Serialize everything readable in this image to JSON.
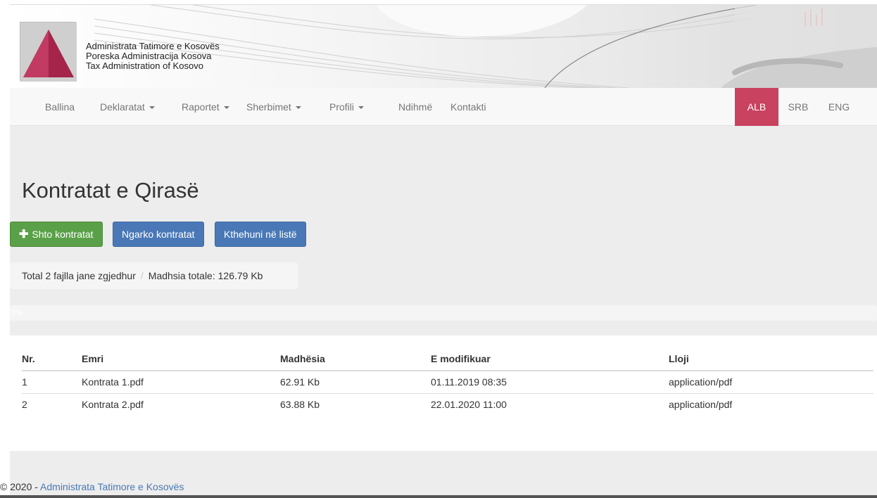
{
  "header": {
    "org_lines": [
      "Administrata Tatimore e Kosovës",
      "Poreska Administracija Kosova",
      "Tax Administration of Kosovo"
    ]
  },
  "nav": {
    "items": [
      {
        "label": "Ballina",
        "dropdown": false
      },
      {
        "label": "Deklaratat",
        "dropdown": true
      },
      {
        "label": "Raportet",
        "dropdown": true
      },
      {
        "label": "Sherbimet",
        "dropdown": true
      },
      {
        "label": "Profili",
        "dropdown": true
      },
      {
        "label": "Ndihmë",
        "dropdown": false
      },
      {
        "label": "Kontakti",
        "dropdown": false
      }
    ],
    "languages": [
      {
        "label": "ALB",
        "active": true
      },
      {
        "label": "SRB",
        "active": false
      },
      {
        "label": "ENG",
        "active": false
      }
    ],
    "active_lang_color": "#c94260"
  },
  "main": {
    "title": "Kontratat e Qirasë",
    "buttons": {
      "add": "Shto kontratat",
      "upload": "Ngarko kontratat",
      "back": "Kthehuni në listë"
    },
    "summary": {
      "selected": "Total 2 fajlla jane zgjedhur",
      "size": "Madhsia totale: 126.79 Kb"
    },
    "progress_label": "0%",
    "table": {
      "headers": [
        "Nr.",
        "Emri",
        "Madhësia",
        "E modifikuar",
        "Lloji"
      ],
      "rows": [
        [
          "1",
          "Kontrata 1.pdf",
          "62.91 Kb",
          "01.11.2019 08:35",
          "application/pdf"
        ],
        [
          "2",
          "Kontrata 2.pdf",
          "63.88 Kb",
          "22.01.2020 11:00",
          "application/pdf"
        ]
      ]
    }
  },
  "footer": {
    "prefix": "© 2020 - ",
    "link": "Administrata Tatimore e Kosovës"
  },
  "colors": {
    "success": "#5aa048",
    "primary": "#4a78b6"
  }
}
